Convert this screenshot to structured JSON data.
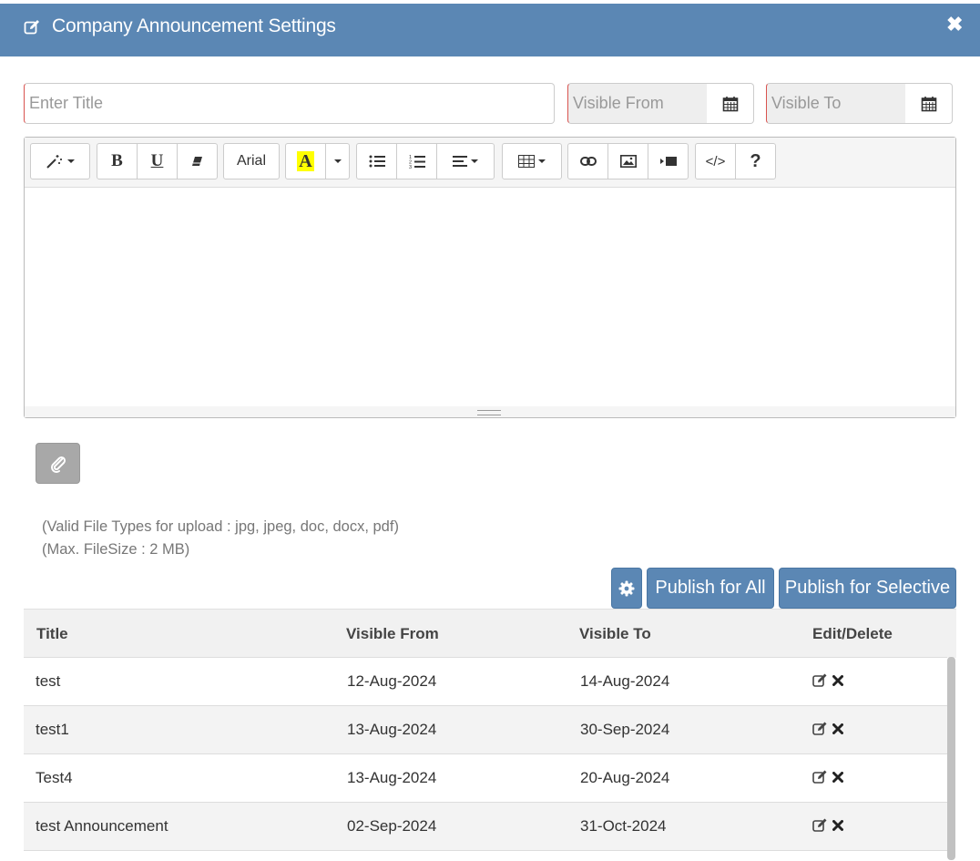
{
  "dialog": {
    "title": "Company Announcement Settings",
    "close_symbol": "✖"
  },
  "form": {
    "title_placeholder": "Enter Title",
    "visible_from_placeholder": "Visible From",
    "visible_to_placeholder": "Visible To"
  },
  "toolbar": {
    "font_name": "Arial",
    "bold_label": "B",
    "underline_label": "U",
    "color_label": "A",
    "code_label": "</>",
    "help_label": "?"
  },
  "upload": {
    "file_types_note": "(Valid File Types for upload : jpg, jpeg, doc, docx, pdf)",
    "max_size_note": "(Max. FileSize : 2 MB)"
  },
  "actions": {
    "publish_all_label": "Publish for All",
    "publish_selective_label": "Publish for Selective"
  },
  "table": {
    "headers": [
      "Title",
      "Visible From",
      "Visible To",
      "Edit/Delete"
    ],
    "rows": [
      {
        "title": "test",
        "visible_from": "12-Aug-2024",
        "visible_to": "14-Aug-2024"
      },
      {
        "title": "test1",
        "visible_from": "13-Aug-2024",
        "visible_to": "30-Sep-2024"
      },
      {
        "title": "Test4",
        "visible_from": "13-Aug-2024",
        "visible_to": "20-Aug-2024"
      },
      {
        "title": "test Announcement",
        "visible_from": "02-Sep-2024",
        "visible_to": "31-Oct-2024"
      }
    ]
  },
  "colors": {
    "header_bg": "#5b87b4",
    "button_bg": "#5b87b4",
    "attach_bg": "#a8a8a8",
    "required_border": "#d9534f",
    "highlight_yellow": "#ffff00"
  }
}
